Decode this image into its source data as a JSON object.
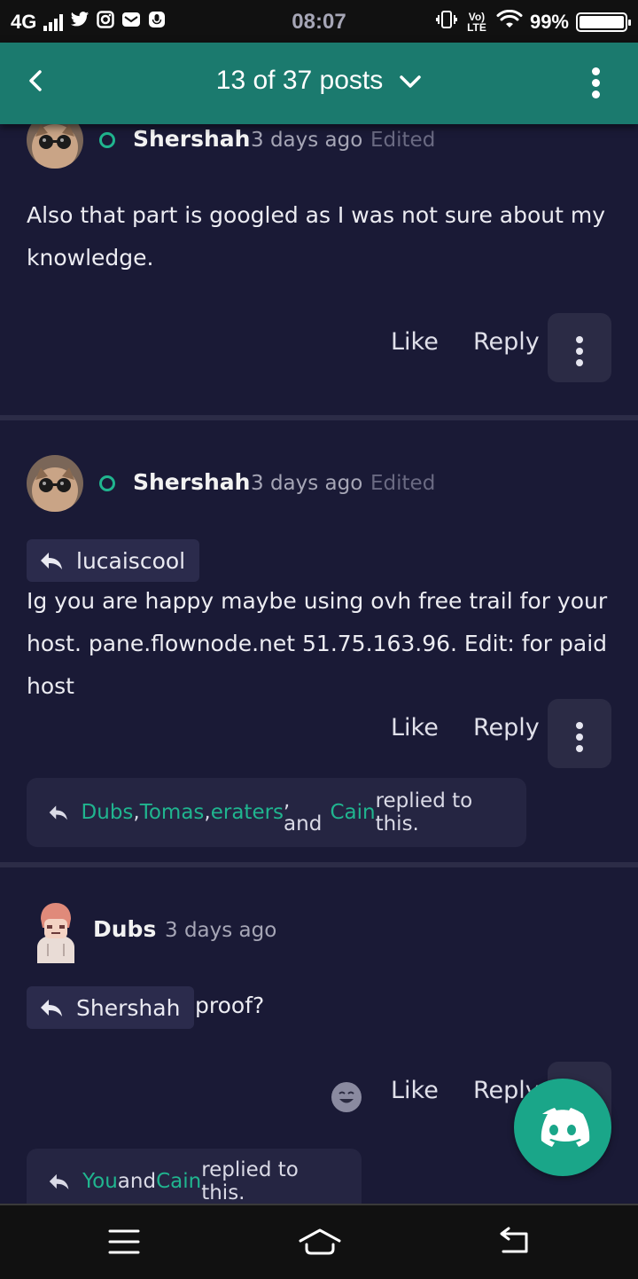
{
  "status_bar": {
    "network": "4G",
    "time": "08:07",
    "lte": "Vo) LTE",
    "battery_pct": "99%",
    "battery_level": 0.99
  },
  "header": {
    "title": "13 of 37 posts"
  },
  "posts": [
    {
      "author": "Shershah",
      "time": "3 days ago",
      "edited": "Edited",
      "body": "Also that part is googled as I was not sure about my knowledge.",
      "like": "Like",
      "reply": "Reply"
    },
    {
      "author": "Shershah",
      "time": "3 days ago",
      "edited": "Edited",
      "quote_user": "lucaiscool",
      "body": "Ig you are happy maybe using ovh free trail for your host. pane.flownode.net 51.75.163.96. Edit: for paid host",
      "like": "Like",
      "reply": "Reply",
      "replied": {
        "users": [
          "Dubs",
          "Tomas",
          "eraters",
          "Cain"
        ],
        "sep1": ", ",
        "sep2": ", ",
        "sep3": ", and ",
        "suffix": " replied to this."
      }
    },
    {
      "author": "Dubs",
      "time": "3 days ago",
      "quote_user": "Shershah",
      "body": "proof?",
      "like": "Like",
      "reply": "Reply",
      "replied": {
        "users": [
          "You",
          "Cain"
        ],
        "sep1": " and ",
        "suffix": " replied to this."
      }
    }
  ],
  "colors": {
    "accent": "#20b58f",
    "header": "#1b7a6e",
    "background": "#1a1a36"
  },
  "icons": {
    "back": "chevron-left-icon",
    "dropdown": "chevron-down-icon",
    "more": "more-vertical-icon",
    "reply": "reply-arrow-icon",
    "fab": "discord-icon",
    "nav_menu": "menu-icon",
    "nav_home": "home-icon",
    "nav_back": "back-icon"
  }
}
